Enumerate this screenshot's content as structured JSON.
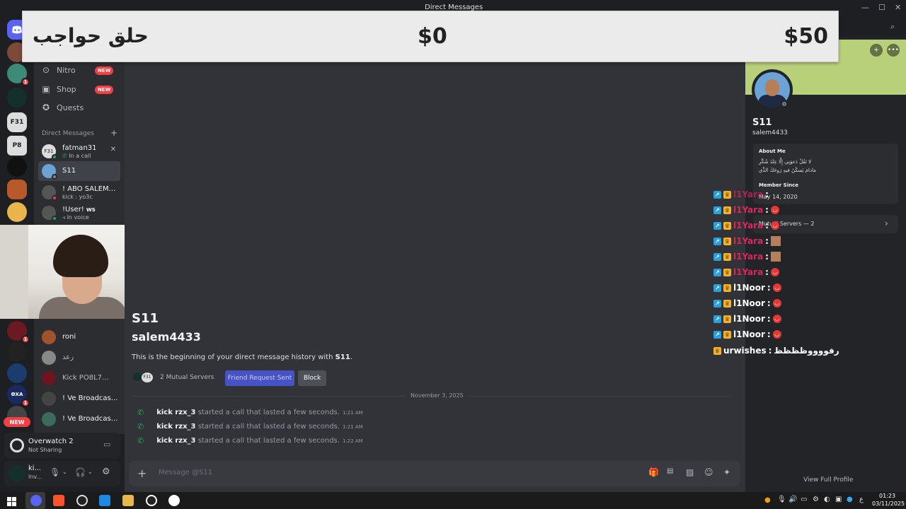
{
  "window": {
    "title": "Direct Messages",
    "minimize": "—",
    "maximize": "☐",
    "close": "✕"
  },
  "overlay": {
    "left_text": "حلق حواجب",
    "mid_text": "$0",
    "right_text": "$50"
  },
  "rail": {
    "new_label": "NEW",
    "server_labels": [
      "F31",
      "P8",
      "ӨXA"
    ],
    "badge_count": "1"
  },
  "sidebar": {
    "nav": [
      {
        "label": "Nitro",
        "badge": "NEW",
        "icon": "nitro-icon"
      },
      {
        "label": "Shop",
        "badge": "NEW",
        "icon": "shop-icon"
      },
      {
        "label": "Quests",
        "icon": "quests-icon"
      }
    ],
    "dm_header": "Direct Messages",
    "dm_add": "+",
    "dms_top": [
      {
        "name": "fatman31",
        "sub": "In a call",
        "avatar": "F31"
      },
      {
        "name": "S11",
        "avatar": ""
      },
      {
        "name": "! ABO SALEM...",
        "sub": "kick : yo3c",
        "avatar": ""
      },
      {
        "name": "!User!",
        "tag": "WS",
        "sub": "In voice",
        "avatar": ""
      }
    ],
    "dms_bottom": [
      {
        "name": "roni"
      },
      {
        "name": "رعد"
      },
      {
        "name": "Kick PO8L7..."
      },
      {
        "name": "! Ve Broadcas..."
      },
      {
        "name": "! Ve Broadcas..."
      }
    ]
  },
  "activity": {
    "game": "Overwatch 2",
    "status": "Not Sharing"
  },
  "user": {
    "name": "ki...",
    "status": "Inv..."
  },
  "main": {
    "profile_name_partial": "S11",
    "username": "salem4433",
    "intro_prefix": "This is the beginning of your direct message history with ",
    "intro_name": "S11",
    "intro_suffix": ".",
    "mutual_servers": "2 Mutual Servers",
    "friend_request": "Friend Request Sent",
    "block": "Block",
    "date_separator": "November 3, 2025",
    "calls": [
      {
        "user": "kick rzx_3",
        "text": "started a call that lasted a few seconds.",
        "time": "1:21 AM"
      },
      {
        "user": "kick rzx_3",
        "text": "started a call that lasted a few seconds.",
        "time": "1:21 AM"
      },
      {
        "user": "kick rzx_3",
        "text": "started a call that lasted a few seconds.",
        "time": "1:22 AM"
      }
    ],
    "composer_placeholder": "Message @S11"
  },
  "profile": {
    "display_name": "S11",
    "username": "salem4433",
    "about_title": "About Me",
    "about_line1": "لا تَقُلْ دَعوَنِي إِلَّا عِنْدَ شُكْرِ",
    "about_line2": "مادامَ يَسكُنُ فيهِ رَوحَكَ الذِّي",
    "member_since_title": "Member Since",
    "member_since": "May 14, 2020",
    "mutual_servers": "Mutual Servers — 2",
    "view_full": "View Full Profile"
  },
  "chat_overlay": [
    {
      "user": "l1Yara",
      "color": "#e0245e"
    },
    {
      "user": "l1Yara",
      "color": "#e0245e"
    },
    {
      "user": "l1Yara",
      "color": "#e0245e"
    },
    {
      "user": "l1Yara",
      "color": "#e0245e"
    },
    {
      "user": "l1Yara",
      "color": "#e0245e"
    },
    {
      "user": "l1Yara",
      "color": "#e0245e"
    },
    {
      "user": "l1Noor",
      "color": "#ffffff"
    },
    {
      "user": "l1Noor",
      "color": "#ffffff"
    },
    {
      "user": "l1Noor",
      "color": "#ffffff"
    },
    {
      "user": "l1Noor",
      "color": "#ffffff"
    }
  ],
  "chat_last": {
    "user": "urwishes",
    "msg": "رفووووظظظظ"
  },
  "taskbar": {
    "time": "01:23",
    "date": "03/11/2025",
    "lang": "ع"
  },
  "colors": {
    "accent": "#5865f2",
    "online": "#23a55a",
    "danger": "#f23f43",
    "banner": "#b9d07a"
  }
}
